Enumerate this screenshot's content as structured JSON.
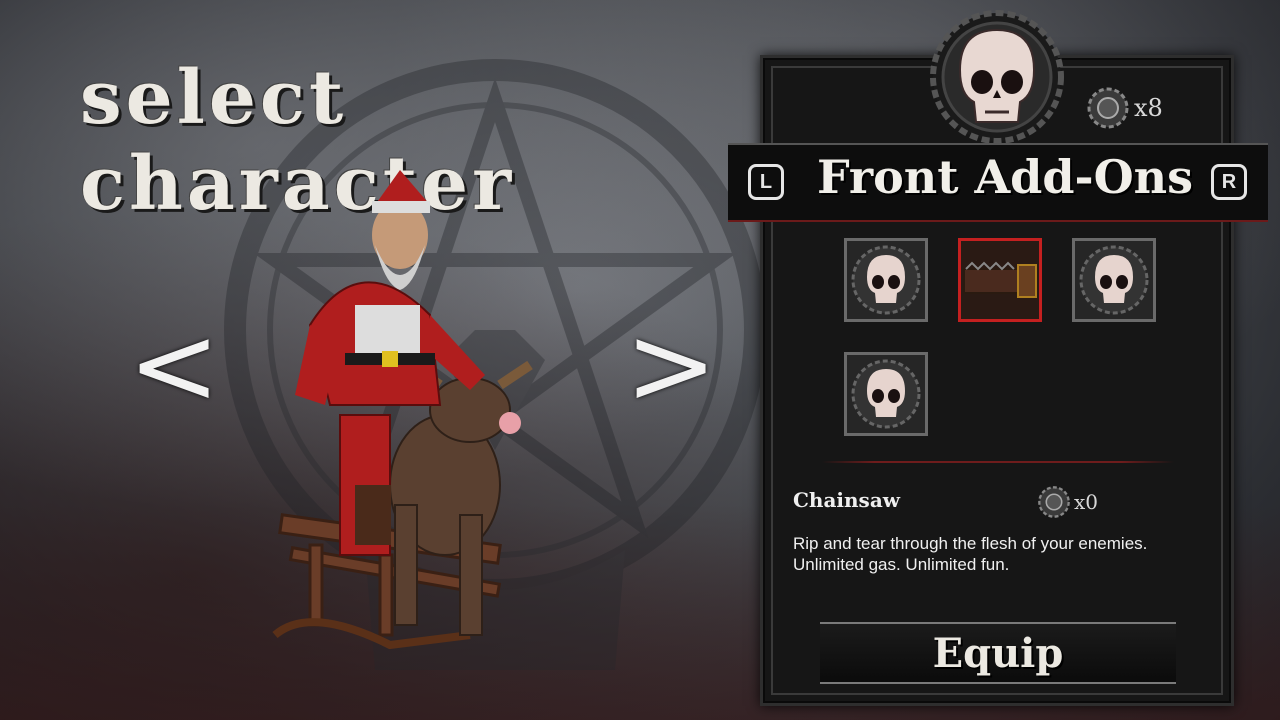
{
  "screen": {
    "title": "select character",
    "prev_arrow": "<",
    "next_arrow": ">"
  },
  "panel": {
    "currency_count": "x8",
    "category_title": "Front Add-Ons",
    "left_button": "L",
    "right_button": "R",
    "slots": [
      {
        "icon": "skull-icon",
        "selected": false
      },
      {
        "icon": "chainsaw-icon",
        "selected": true
      },
      {
        "icon": "skull-icon",
        "selected": false
      },
      {
        "icon": "skull-icon",
        "selected": false
      }
    ],
    "selected_item": {
      "name": "Chainsaw",
      "count": "x0",
      "description": "Rip and tear through the flesh of your enemies. Unlimited gas. Unlimited fun."
    },
    "equip_label": "Equip"
  },
  "colors": {
    "accent_red": "#c42020",
    "panel_bg": "#161616"
  }
}
